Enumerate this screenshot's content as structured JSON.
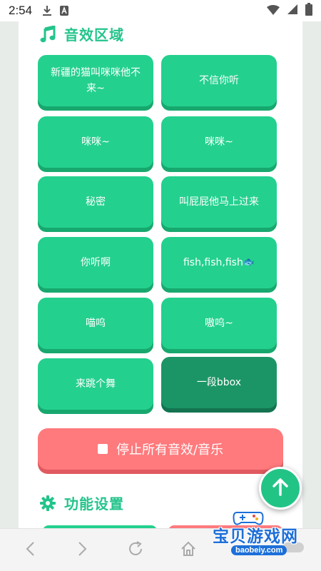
{
  "status_bar": {
    "time": "2:54",
    "icons": [
      "download-icon",
      "a-badge-icon",
      "wifi-icon",
      "signal-icon",
      "battery-icon"
    ]
  },
  "sections": {
    "sound_title": "音效区域",
    "settings_title": "功能设置"
  },
  "sound_buttons": [
    {
      "label": "新疆的猫叫咪咪他不来~"
    },
    {
      "label": "不信你听"
    },
    {
      "label": "咪咪~"
    },
    {
      "label": "咪咪~"
    },
    {
      "label": "秘密"
    },
    {
      "label": "叫屁屁他马上过来"
    },
    {
      "label": "你听啊"
    },
    {
      "label": "fish,fish,fish",
      "emoji": "🐟"
    },
    {
      "label": "喵呜"
    },
    {
      "label": "嗷呜~"
    },
    {
      "label": "来跳个舞"
    },
    {
      "label": "一段bbox",
      "active": true
    }
  ],
  "stop_button": {
    "label": "停止所有音效/音乐"
  },
  "watermark": {
    "title": "宝贝游戏网",
    "url": "baobeiy.com"
  },
  "colors": {
    "accent": "#24d08e",
    "accent_dark": "#1b9565",
    "stop": "#ff7a7d",
    "page_bg": "#e7ece9",
    "watermark_blue": "#1d6fd8"
  },
  "toolbar": {
    "icons": [
      "back-icon",
      "forward-icon",
      "reload-icon",
      "home-icon"
    ]
  }
}
